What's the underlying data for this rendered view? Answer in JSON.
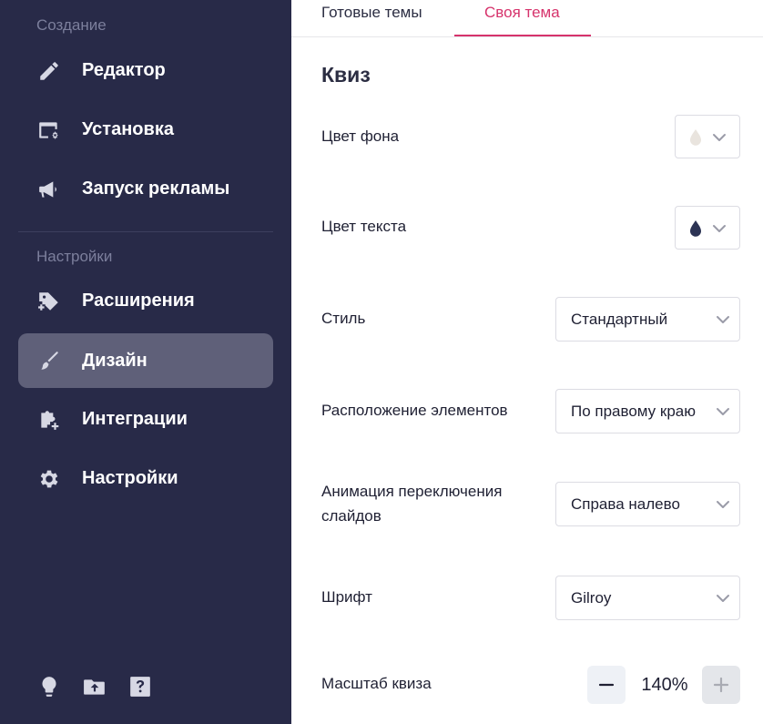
{
  "sidebar": {
    "section_create": "Создание",
    "section_settings": "Настройки",
    "items": [
      {
        "label": "Редактор",
        "icon": "pencil-icon"
      },
      {
        "label": "Установка",
        "icon": "install-icon"
      },
      {
        "label": "Запуск рекламы",
        "icon": "megaphone-icon"
      },
      {
        "label": "Расширения",
        "icon": "tag-plus-icon"
      },
      {
        "label": "Дизайн",
        "icon": "brush-icon",
        "active": true
      },
      {
        "label": "Интеграции",
        "icon": "puzzle-plus-icon"
      },
      {
        "label": "Настройки",
        "icon": "gear-icon"
      }
    ],
    "bottom_icons": [
      "lightbulb-icon",
      "folder-upload-icon",
      "help-icon"
    ]
  },
  "tabs": [
    {
      "label": "Готовые темы"
    },
    {
      "label": "Своя тема",
      "active": true
    }
  ],
  "section": {
    "title": "Квиз"
  },
  "settings": {
    "background_color": {
      "label": "Цвет фона",
      "color": "#e9e4de"
    },
    "text_color": {
      "label": "Цвет текста",
      "color": "#2c3354"
    },
    "style": {
      "label": "Стиль",
      "value": "Стандартный"
    },
    "layout": {
      "label": "Расположение элементов",
      "value": "По правому краю"
    },
    "animation": {
      "label": "Анимация переключения слайдов",
      "value": "Справа налево"
    },
    "font": {
      "label": "Шрифт",
      "value": "Gilroy"
    },
    "scale": {
      "label": "Масштаб квиза",
      "value": "140%"
    }
  },
  "colors": {
    "sidebar_bg": "#282a48",
    "active_item_bg": "#5f6079",
    "accent": "#d6336c"
  }
}
